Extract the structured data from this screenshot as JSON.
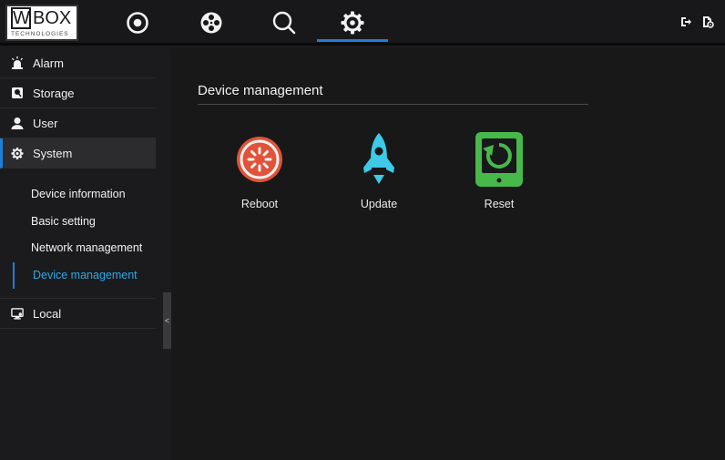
{
  "logo": {
    "letter": "W",
    "word": "BOX",
    "sub": "TECHNOLOGIES"
  },
  "nav": [
    {
      "id": "live",
      "icon": "live-view-icon"
    },
    {
      "id": "playback",
      "icon": "film-reel-icon"
    },
    {
      "id": "search",
      "icon": "search-icon"
    },
    {
      "id": "settings",
      "icon": "gear-icon",
      "active": true
    }
  ],
  "topright": [
    {
      "icon": "logout-icon"
    },
    {
      "icon": "file-settings-icon"
    }
  ],
  "sidebar": {
    "items": [
      {
        "label": "Alarm",
        "icon": "alarm-icon"
      },
      {
        "label": "Storage",
        "icon": "storage-icon"
      },
      {
        "label": "User",
        "icon": "user-icon"
      },
      {
        "label": "System",
        "icon": "gear-icon",
        "active": true
      }
    ],
    "sub": [
      {
        "label": "Device information"
      },
      {
        "label": "Basic setting"
      },
      {
        "label": "Network management"
      },
      {
        "label": "Device management",
        "active": true
      }
    ],
    "local": {
      "label": "Local",
      "icon": "monitor-icon"
    },
    "collapse": "<"
  },
  "main": {
    "title": "Device management",
    "actions": [
      {
        "label": "Reboot",
        "icon": "reboot-icon",
        "color": "#e0533a"
      },
      {
        "label": "Update",
        "icon": "rocket-icon",
        "color": "#3ec9e8"
      },
      {
        "label": "Reset",
        "icon": "reset-tablet-icon",
        "color": "#47b84a"
      }
    ]
  },
  "colors": {
    "accent": "#1e7fd6",
    "active_text": "#2ea8e6",
    "background": "#181818"
  }
}
